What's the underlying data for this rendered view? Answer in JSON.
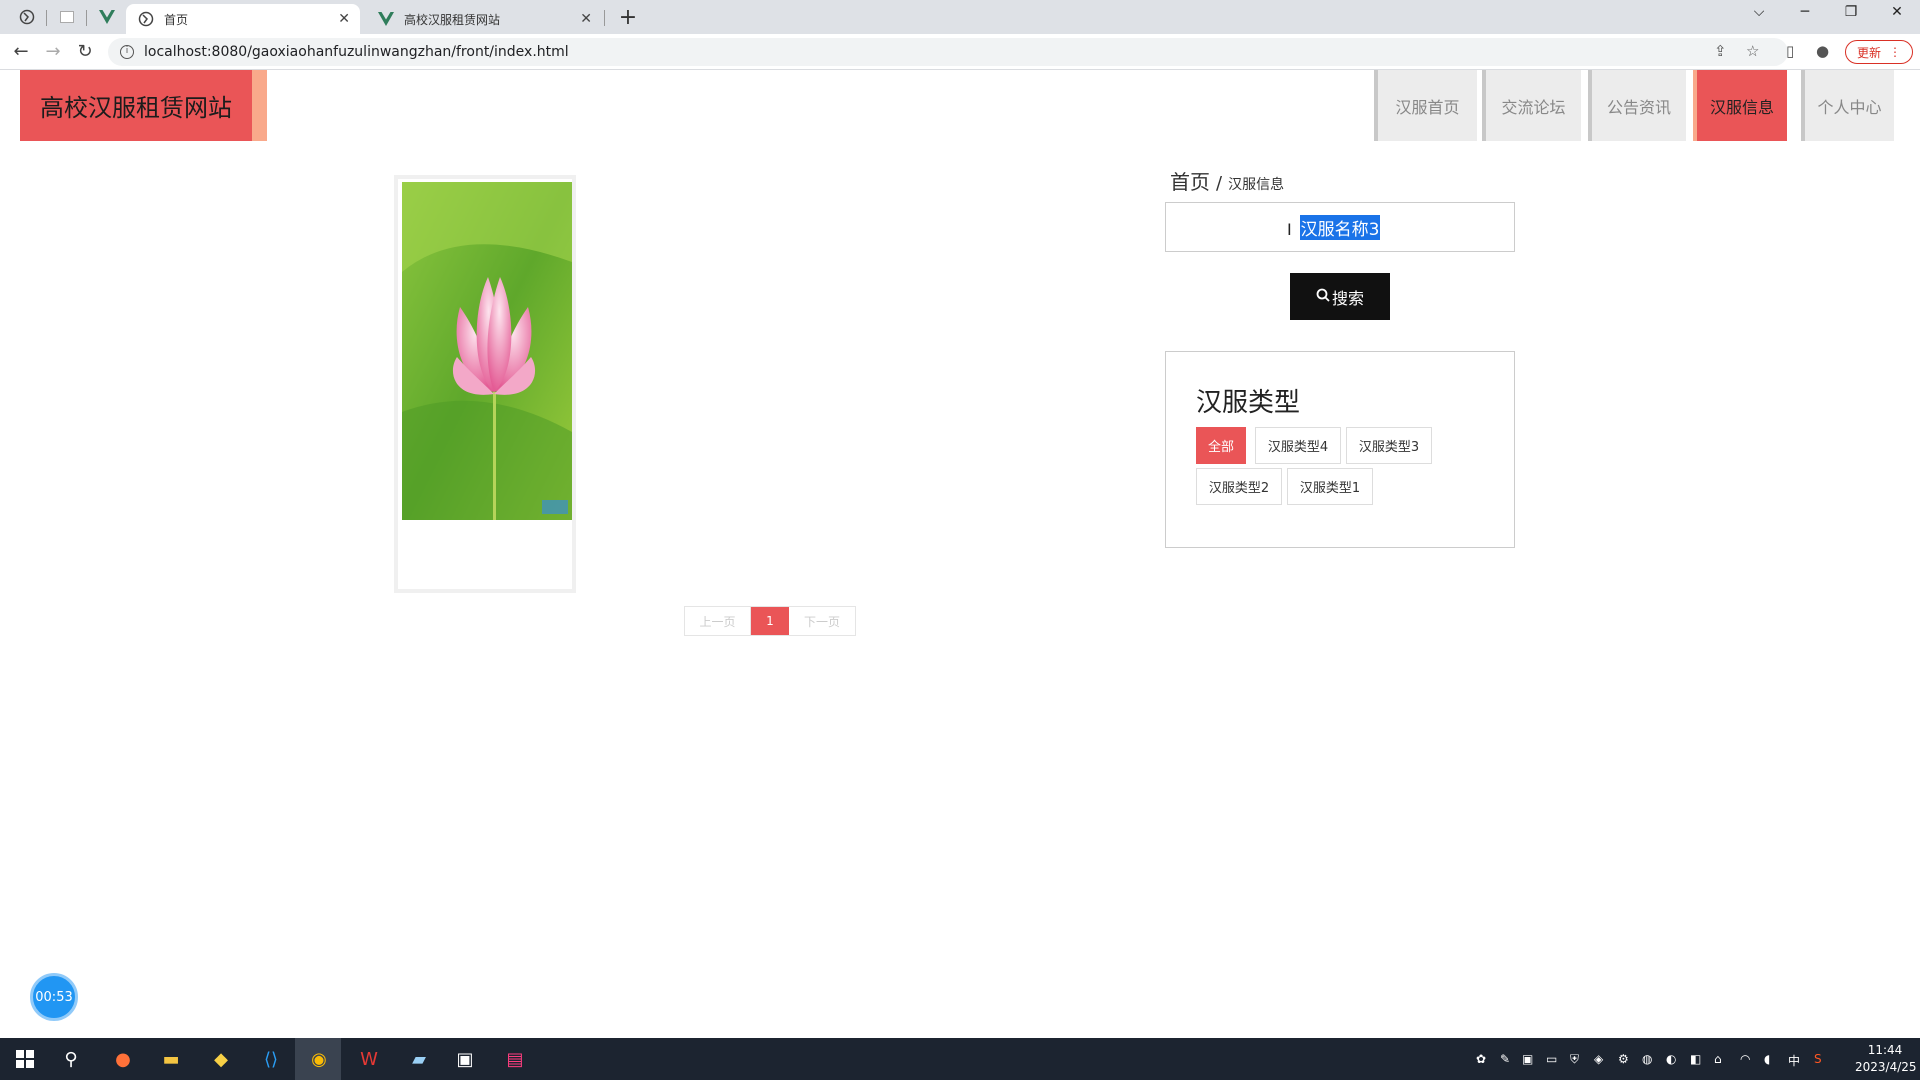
{
  "browser": {
    "tabs": [
      {
        "title": "首页",
        "active": true
      },
      {
        "title": "高校汉服租赁网站",
        "active": false
      }
    ],
    "url": "localhost:8080/gaoxiaohanfuzulinwangzhan/front/index.html",
    "update_label": "更新"
  },
  "site": {
    "logo": "高校汉服租赁网站",
    "nav": [
      {
        "label": "汉服首页",
        "active": false
      },
      {
        "label": "交流论坛",
        "active": false
      },
      {
        "label": "公告资讯",
        "active": false
      },
      {
        "label": "汉服信息",
        "active": true
      },
      {
        "label": "个人中心",
        "active": false
      }
    ],
    "pager": {
      "prev": "上一页",
      "current": "1",
      "next": "下一页"
    },
    "breadcrumb": {
      "home": "首页",
      "sep": "/",
      "current": "汉服信息"
    },
    "search": {
      "value": "汉服名称3",
      "button": "搜索"
    },
    "types": {
      "title": "汉服类型",
      "items": [
        "全部",
        "汉服类型4",
        "汉服类型3",
        "汉服类型2",
        "汉服类型1"
      ]
    },
    "timer": "00:53"
  },
  "taskbar": {
    "clock_time": "11:44",
    "clock_date": "2023/4/25",
    "ime": "中"
  },
  "colors": {
    "accent": "#ea5557",
    "accent_light": "#f9a98b"
  }
}
